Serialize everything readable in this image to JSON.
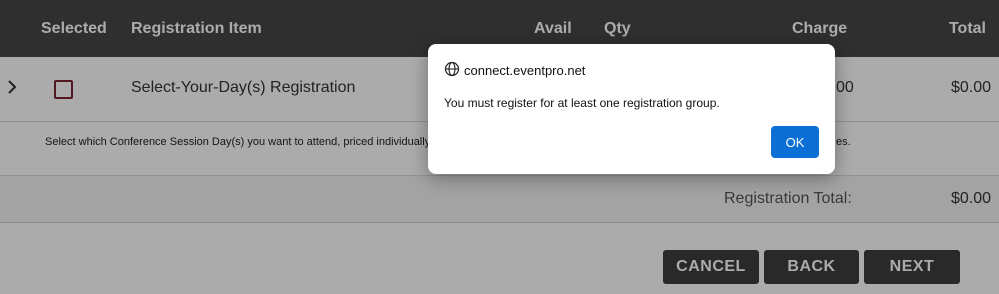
{
  "table": {
    "headers": {
      "selected": "Selected",
      "item": "Registration Item",
      "avail": "Avail",
      "qty": "Qty",
      "charge": "Charge",
      "total": "Total"
    },
    "rows": [
      {
        "expand_icon": "chevron-right-icon",
        "selected": false,
        "item": "Select-Your-Day(s) Registration",
        "charge_fragment": "00",
        "total": "$0.00",
        "description_visible_left": "Select which Conference Session Day(s) you want to attend, priced individually c",
        "description_visible_right": "es."
      }
    ],
    "registration_total_label": "Registration Total:",
    "registration_total_value": "$0.00"
  },
  "buttons": {
    "cancel": "CANCEL",
    "back": "BACK",
    "next": "NEXT"
  },
  "dialog": {
    "origin_icon": "globe-icon",
    "origin": "connect.eventpro.net",
    "message": "You must register for at least one registration group.",
    "ok": "OK"
  },
  "colors": {
    "header_bg": "#474747",
    "button_bg": "#3e3e3e",
    "checkbox_border": "#7a2436",
    "ok_button": "#0b6fd6"
  }
}
